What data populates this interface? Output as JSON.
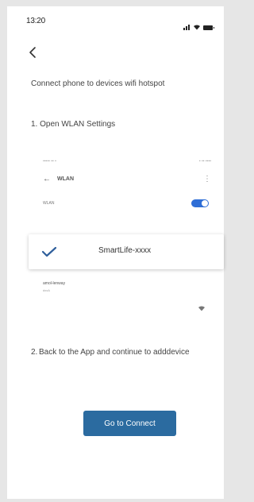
{
  "status_bar": {
    "time": "13:20"
  },
  "nav": {
    "back_icon": "chevron-left-icon"
  },
  "instruction": "Connect phone to devices wifi hotspot",
  "step1": {
    "label": "1. Open WLAN Settings"
  },
  "mock_settings": {
    "title": "WLAN",
    "wlan_label": "WLAN",
    "wlan_enabled": true,
    "selected_network": "SmartLife-xxxx",
    "other_network": "amol-lenway",
    "other_network_sub": "dxxA"
  },
  "step2": {
    "number": "2.",
    "text": "Back to the App and continue to adddevice"
  },
  "primary_button": {
    "label": "Go to Connect"
  },
  "colors": {
    "accent": "#2b6ba0",
    "check": "#2f5f9c",
    "toggle": "#2f6ed6"
  }
}
